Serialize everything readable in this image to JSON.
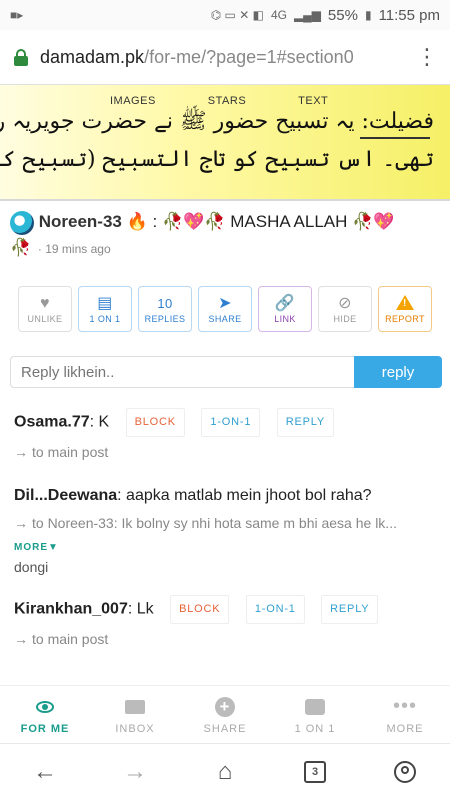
{
  "status_bar": {
    "battery": "55%",
    "time": "11:55 pm",
    "network": "4G"
  },
  "browser": {
    "url_host": "damadam.pk",
    "url_path": "/for-me/?page=1#section0"
  },
  "banner": {
    "tabs": [
      "IMAGES",
      "STARS",
      "TEXT"
    ],
    "line1": "فضیلت: یہ تسبیح حضور ﷺ نے حضرت جویریہ رضی اللہ عنہا کو سکھائی",
    "line2": "تھی۔ اس تسبیح کو تاج التسبیح (تسبیح کا سردار) کہا جاتا ہے۔"
  },
  "post": {
    "author": "Noreen-33",
    "text": "MASHA ALLAH",
    "time": "19 mins ago"
  },
  "actions": {
    "unlike": "UNLIKE",
    "one_on_one": "1 ON 1",
    "replies_count": "10",
    "replies": "REPLIES",
    "share": "SHARE",
    "link": "LINK",
    "hide": "HIDE",
    "report": "REPORT"
  },
  "reply_box": {
    "placeholder": "Reply likhein..",
    "button": "reply"
  },
  "comment_buttons": {
    "block": "BLOCK",
    "one_on_one": "1-ON-1",
    "reply": "REPLY"
  },
  "comments": [
    {
      "author": "Osama.77",
      "text": "K",
      "sub": "to main post"
    },
    {
      "author": "Dil...Deewana",
      "text": "aapka matlab mein jhoot bol raha?",
      "sub": "to Noreen-33: Ik bolny sy nhi hota same m bhi aesa he lk...",
      "more": "MORE",
      "extra": "dongi"
    },
    {
      "author": "Kirankhan_007",
      "text": "Lk",
      "sub": "to main post"
    }
  ],
  "bottom_nav": [
    {
      "label": "FOR ME",
      "active": true
    },
    {
      "label": "INBOX"
    },
    {
      "label": "SHARE"
    },
    {
      "label": "1 ON 1"
    },
    {
      "label": "MORE"
    }
  ],
  "system_nav": {
    "tabs_count": "3"
  }
}
